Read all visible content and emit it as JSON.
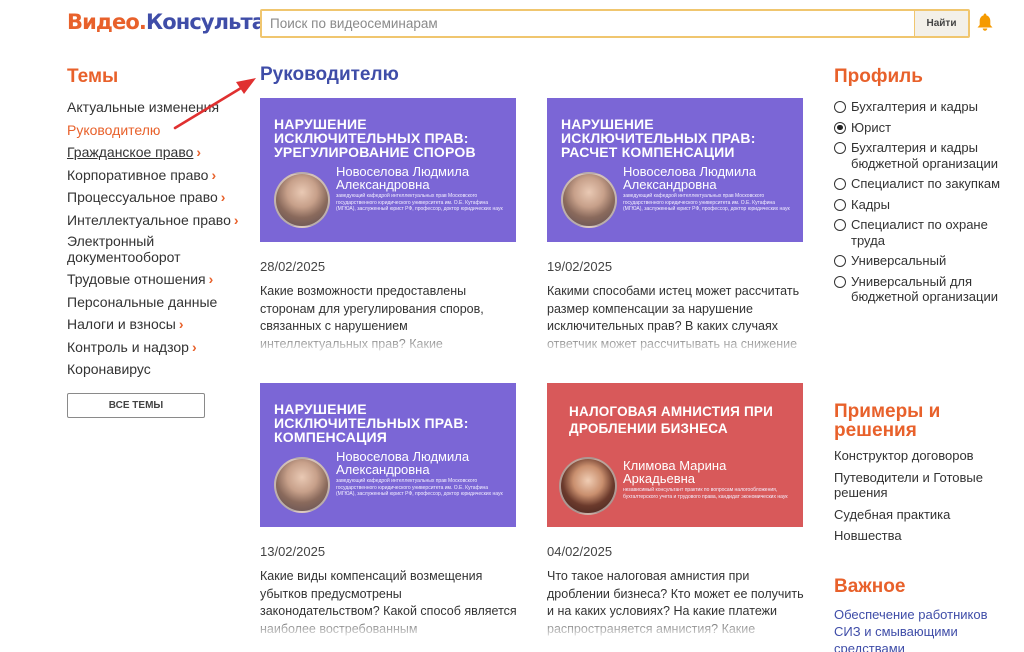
{
  "header": {
    "logo_part1": "Видео.",
    "logo_part2": "Консультант",
    "search_placeholder": "Поиск по видеосеминарам",
    "search_button": "Найти",
    "bell_icon": "bell-icon",
    "bell_color": "#f59a00"
  },
  "colors": {
    "accent_orange": "#e8612b",
    "accent_blue": "#3f4da8",
    "banner_purple": "#7b66d6",
    "banner_red": "#d8595a",
    "arrow_red": "#e03030"
  },
  "left": {
    "title": "Темы",
    "topics": [
      {
        "label": "Актуальные изменения",
        "chevron": ""
      },
      {
        "label": "Руководителю",
        "chevron": ""
      },
      {
        "label": "Гражданское право",
        "chevron": "›"
      },
      {
        "label": "Корпоративное право",
        "chevron": "›"
      },
      {
        "label": "Процессуальное право",
        "chevron": "›"
      },
      {
        "label": "Интеллектуальное право",
        "chevron": "›"
      },
      {
        "label": "Электронный документооборот",
        "chevron": ""
      },
      {
        "label": "Трудовые отношения",
        "chevron": "›"
      },
      {
        "label": "Персональные данные",
        "chevron": ""
      },
      {
        "label": "Налоги и взносы",
        "chevron": "›"
      },
      {
        "label": "Контроль и надзор",
        "chevron": "›"
      },
      {
        "label": "Коронавирус",
        "chevron": ""
      }
    ],
    "all_themes_button": "ВСЕ ТЕМЫ"
  },
  "center": {
    "title": "Руководителю",
    "cards": [
      {
        "banner_title": "Нарушение исключительных прав: урегулирование споров",
        "speaker": "Новоселова Людмила Александровна",
        "speaker_desc": "заведующий кафедрой интеллектуальных прав Московского государственного юридического университета им. О.Е. Кутафина (МГЮА), заслуженный юрист РФ, профессор, доктор юридических наук",
        "date": "28/02/2025",
        "description": "Какие возможности предоставлены сторонам для урегулирования споров, связанных с нарушением интеллектуальных прав? Какие рекомендации по этому поводу дает ВАС РФ? Для каких категорий"
      },
      {
        "banner_title": "Нарушение исключительных прав: расчет компенсации",
        "speaker": "Новоселова Людмила Александровна",
        "speaker_desc": "заведующий кафедрой интеллектуальных прав Московского государственного юридического университета им. О.Е. Кутафина (МГЮА), заслуженный юрист РФ, профессор, доктор юридических наук",
        "date": "19/02/2025",
        "description": "Какими способами истец может рассчитать размер компенсации за нарушение исключительных прав? В каких случаях ответчик может рассчитывать на снижение штрафных санкций? Лектор рассмотрит"
      },
      {
        "banner_title": "Нарушение исключительных прав: компенсация",
        "speaker": "Новоселова Людмила Александровна",
        "speaker_desc": "заведующий кафедрой интеллектуальных прав Московского государственного юридического университета им. О.Е. Кутафина (МГЮА), заслуженный юрист РФ, профессор, доктор юридических наук",
        "date": "13/02/2025",
        "description": "Какие виды компенсаций возмещения убытков предусмотрены законодательством? Какой способ является наиболее востребованным правообладателем? Как развивалась"
      },
      {
        "banner_title": "Налоговая амнистия при дроблении бизнеса",
        "speaker": "Климова Марина Аркадьевна",
        "speaker_desc": "независимый консультант практик по вопросам налогообложения, бухгалтерского учета и трудового права, кандидат экономических наук",
        "date": "04/02/2025",
        "description": "Что такое налоговая амнистия при дроблении бизнеса? Кто может ее получить и на каких условиях? На какие платежи распространяется амнистия? Какие нарушения связаны с дроблением, а какие"
      }
    ]
  },
  "right": {
    "profile_title": "Профиль",
    "profiles": [
      {
        "label": "Бухгалтерия и кадры",
        "checked": false
      },
      {
        "label": "Юрист",
        "checked": true
      },
      {
        "label": "Бухгалтерия и кадры бюджетной организации",
        "checked": false
      },
      {
        "label": "Специалист по закупкам",
        "checked": false
      },
      {
        "label": "Кадры",
        "checked": false
      },
      {
        "label": "Специалист по охране труда",
        "checked": false
      },
      {
        "label": "Универсальный",
        "checked": false
      },
      {
        "label": "Универсальный для бюджетной организации",
        "checked": false
      }
    ],
    "examples_title": "Примеры и решения",
    "examples": [
      "Конструктор договоров",
      "Путеводители и Готовые решения",
      "Судебная практика",
      "Новшества"
    ],
    "important_title": "Важное",
    "important_links": [
      "Обеспечение работников СИЗ и смывающими средствами"
    ]
  }
}
